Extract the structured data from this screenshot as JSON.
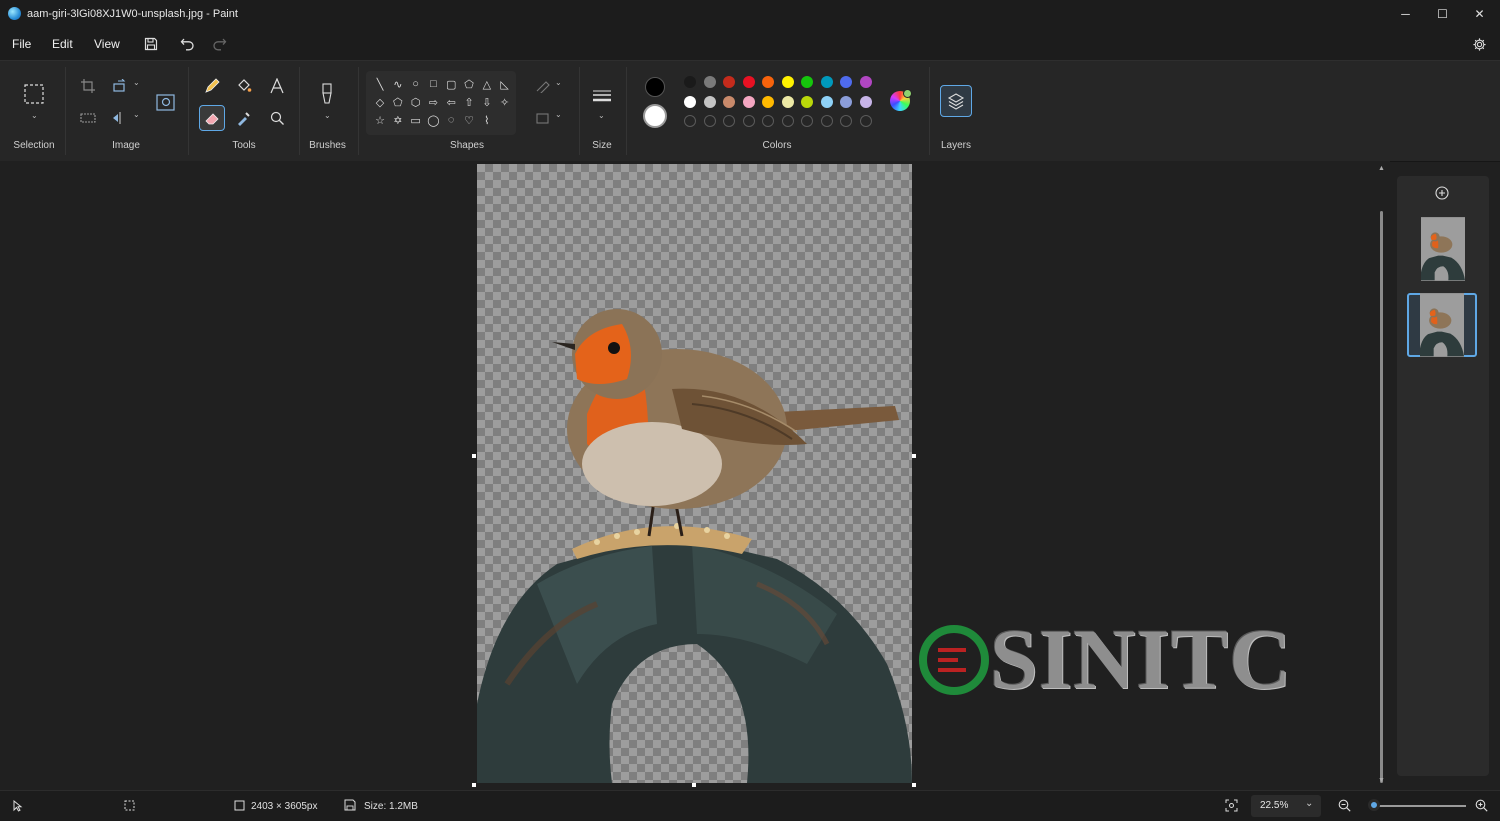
{
  "window": {
    "title": "aam-giri-3lGi08XJ1W0-unsplash.jpg - Paint",
    "minimize": "─",
    "maximize": "☐",
    "close": "✕"
  },
  "menu": {
    "file": "File",
    "edit": "Edit",
    "view": "View"
  },
  "ribbon": {
    "groups": {
      "selection": "Selection",
      "image": "Image",
      "tools": "Tools",
      "brushes": "Brushes",
      "shapes": "Shapes",
      "size": "Size",
      "colors": "Colors",
      "layers": "Layers"
    },
    "shape_glyphs": [
      [
        "╲",
        "∿",
        "○",
        "□",
        "▢",
        "⬠",
        "△",
        "◺"
      ],
      [
        "◇",
        "⬠",
        "⬡",
        "⇨",
        "⇦",
        "⇧",
        "⇩",
        "✧"
      ],
      [
        "☆",
        "✡",
        "▭",
        "◯",
        "◌",
        "♡",
        "⌇"
      ]
    ],
    "primary_color": "#000000",
    "secondary_color": "#ffffff",
    "palette_row1": [
      "#1a1a1a",
      "#7a7a7a",
      "#c42b1c",
      "#e81123",
      "#f7630c",
      "#fff100",
      "#16c60c",
      "#0099bc",
      "#4f6bed",
      "#b146c2"
    ],
    "palette_row2": [
      "#ffffff",
      "#c4c4c4",
      "#c98a6b",
      "#f4a6c1",
      "#ffb900",
      "#ece8a5",
      "#bad80a",
      "#8ed1f7",
      "#8b9dd9",
      "#c7b4e8"
    ]
  },
  "status": {
    "dimensions": "2403 × 3605px",
    "size": "Size: 1.2MB",
    "zoom": "22.5%"
  },
  "zoom_level_fraction": 0.05,
  "watermark": {
    "text": "SINITC"
  }
}
